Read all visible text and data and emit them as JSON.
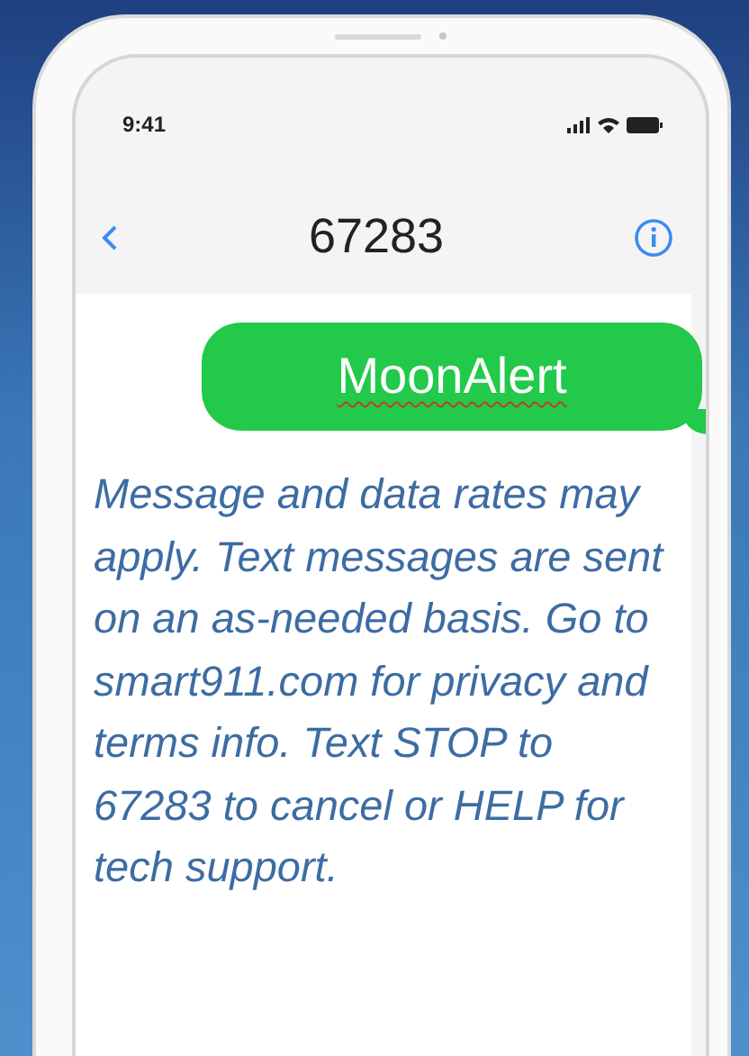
{
  "status_bar": {
    "time": "9:41"
  },
  "header": {
    "title": "67283"
  },
  "messages": [
    {
      "kind": "sent",
      "text": "MoonAlert",
      "misspelled": true
    },
    {
      "kind": "received",
      "text": "Message and data rates may apply. Text messages are sent on an as-needed basis. Go to smart911.com for privacy and terms info. Text STOP to 67283 to cancel or HELP for tech support.",
      "misspelled": false
    }
  ]
}
